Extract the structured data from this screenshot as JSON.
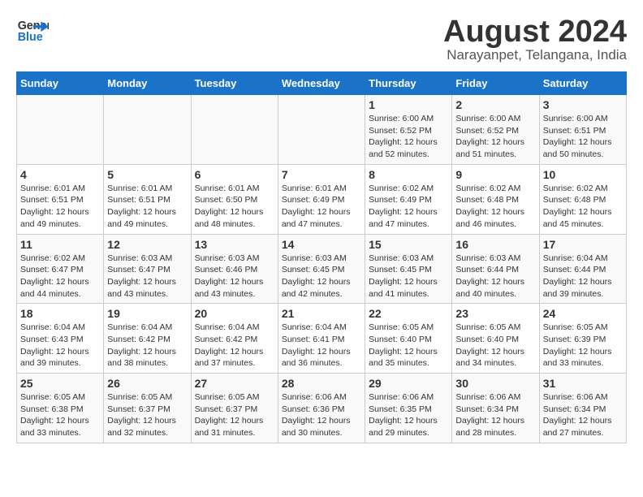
{
  "logo": {
    "line1": "General",
    "line2": "Blue"
  },
  "title": "August 2024",
  "subtitle": "Narayanpet, Telangana, India",
  "headers": [
    "Sunday",
    "Monday",
    "Tuesday",
    "Wednesday",
    "Thursday",
    "Friday",
    "Saturday"
  ],
  "weeks": [
    [
      {
        "day": "",
        "info": ""
      },
      {
        "day": "",
        "info": ""
      },
      {
        "day": "",
        "info": ""
      },
      {
        "day": "",
        "info": ""
      },
      {
        "day": "1",
        "info": "Sunrise: 6:00 AM\nSunset: 6:52 PM\nDaylight: 12 hours\nand 52 minutes."
      },
      {
        "day": "2",
        "info": "Sunrise: 6:00 AM\nSunset: 6:52 PM\nDaylight: 12 hours\nand 51 minutes."
      },
      {
        "day": "3",
        "info": "Sunrise: 6:00 AM\nSunset: 6:51 PM\nDaylight: 12 hours\nand 50 minutes."
      }
    ],
    [
      {
        "day": "4",
        "info": "Sunrise: 6:01 AM\nSunset: 6:51 PM\nDaylight: 12 hours\nand 49 minutes."
      },
      {
        "day": "5",
        "info": "Sunrise: 6:01 AM\nSunset: 6:51 PM\nDaylight: 12 hours\nand 49 minutes."
      },
      {
        "day": "6",
        "info": "Sunrise: 6:01 AM\nSunset: 6:50 PM\nDaylight: 12 hours\nand 48 minutes."
      },
      {
        "day": "7",
        "info": "Sunrise: 6:01 AM\nSunset: 6:49 PM\nDaylight: 12 hours\nand 47 minutes."
      },
      {
        "day": "8",
        "info": "Sunrise: 6:02 AM\nSunset: 6:49 PM\nDaylight: 12 hours\nand 47 minutes."
      },
      {
        "day": "9",
        "info": "Sunrise: 6:02 AM\nSunset: 6:48 PM\nDaylight: 12 hours\nand 46 minutes."
      },
      {
        "day": "10",
        "info": "Sunrise: 6:02 AM\nSunset: 6:48 PM\nDaylight: 12 hours\nand 45 minutes."
      }
    ],
    [
      {
        "day": "11",
        "info": "Sunrise: 6:02 AM\nSunset: 6:47 PM\nDaylight: 12 hours\nand 44 minutes."
      },
      {
        "day": "12",
        "info": "Sunrise: 6:03 AM\nSunset: 6:47 PM\nDaylight: 12 hours\nand 43 minutes."
      },
      {
        "day": "13",
        "info": "Sunrise: 6:03 AM\nSunset: 6:46 PM\nDaylight: 12 hours\nand 43 minutes."
      },
      {
        "day": "14",
        "info": "Sunrise: 6:03 AM\nSunset: 6:45 PM\nDaylight: 12 hours\nand 42 minutes."
      },
      {
        "day": "15",
        "info": "Sunrise: 6:03 AM\nSunset: 6:45 PM\nDaylight: 12 hours\nand 41 minutes."
      },
      {
        "day": "16",
        "info": "Sunrise: 6:03 AM\nSunset: 6:44 PM\nDaylight: 12 hours\nand 40 minutes."
      },
      {
        "day": "17",
        "info": "Sunrise: 6:04 AM\nSunset: 6:44 PM\nDaylight: 12 hours\nand 39 minutes."
      }
    ],
    [
      {
        "day": "18",
        "info": "Sunrise: 6:04 AM\nSunset: 6:43 PM\nDaylight: 12 hours\nand 39 minutes."
      },
      {
        "day": "19",
        "info": "Sunrise: 6:04 AM\nSunset: 6:42 PM\nDaylight: 12 hours\nand 38 minutes."
      },
      {
        "day": "20",
        "info": "Sunrise: 6:04 AM\nSunset: 6:42 PM\nDaylight: 12 hours\nand 37 minutes."
      },
      {
        "day": "21",
        "info": "Sunrise: 6:04 AM\nSunset: 6:41 PM\nDaylight: 12 hours\nand 36 minutes."
      },
      {
        "day": "22",
        "info": "Sunrise: 6:05 AM\nSunset: 6:40 PM\nDaylight: 12 hours\nand 35 minutes."
      },
      {
        "day": "23",
        "info": "Sunrise: 6:05 AM\nSunset: 6:40 PM\nDaylight: 12 hours\nand 34 minutes."
      },
      {
        "day": "24",
        "info": "Sunrise: 6:05 AM\nSunset: 6:39 PM\nDaylight: 12 hours\nand 33 minutes."
      }
    ],
    [
      {
        "day": "25",
        "info": "Sunrise: 6:05 AM\nSunset: 6:38 PM\nDaylight: 12 hours\nand 33 minutes."
      },
      {
        "day": "26",
        "info": "Sunrise: 6:05 AM\nSunset: 6:37 PM\nDaylight: 12 hours\nand 32 minutes."
      },
      {
        "day": "27",
        "info": "Sunrise: 6:05 AM\nSunset: 6:37 PM\nDaylight: 12 hours\nand 31 minutes."
      },
      {
        "day": "28",
        "info": "Sunrise: 6:06 AM\nSunset: 6:36 PM\nDaylight: 12 hours\nand 30 minutes."
      },
      {
        "day": "29",
        "info": "Sunrise: 6:06 AM\nSunset: 6:35 PM\nDaylight: 12 hours\nand 29 minutes."
      },
      {
        "day": "30",
        "info": "Sunrise: 6:06 AM\nSunset: 6:34 PM\nDaylight: 12 hours\nand 28 minutes."
      },
      {
        "day": "31",
        "info": "Sunrise: 6:06 AM\nSunset: 6:34 PM\nDaylight: 12 hours\nand 27 minutes."
      }
    ]
  ]
}
